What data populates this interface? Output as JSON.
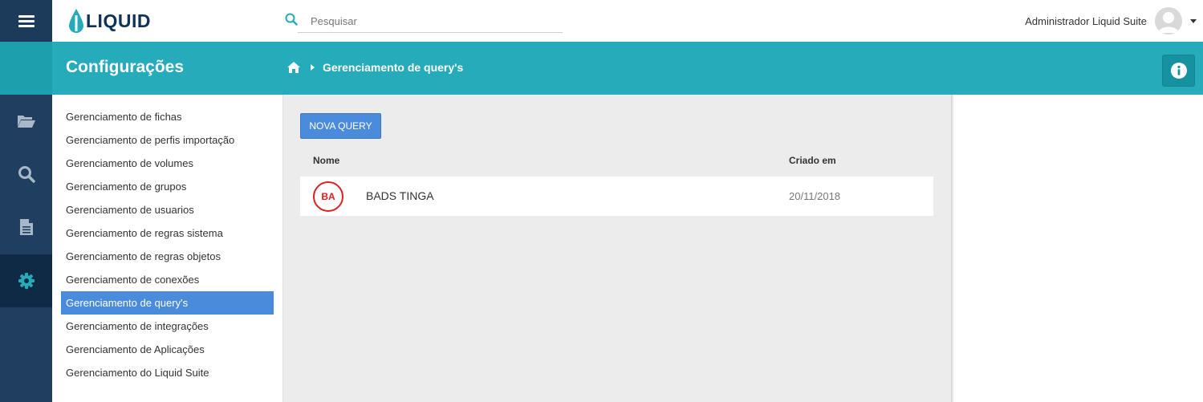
{
  "app": {
    "logo_text": "LIQUID"
  },
  "search": {
    "placeholder": "Pesquisar",
    "value": ""
  },
  "user": {
    "name": "Administrador Liquid Suite"
  },
  "header": {
    "title": "Configurações",
    "breadcrumb_current": "Gerenciamento de query's"
  },
  "settings_menu": {
    "items": [
      {
        "label": "Gerenciamento de fichas",
        "active": false
      },
      {
        "label": "Gerenciamento de perfis importação",
        "active": false
      },
      {
        "label": "Gerenciamento de volumes",
        "active": false
      },
      {
        "label": "Gerenciamento de grupos",
        "active": false
      },
      {
        "label": "Gerenciamento de usuarios",
        "active": false
      },
      {
        "label": "Gerenciamento de regras sistema",
        "active": false
      },
      {
        "label": "Gerenciamento de regras objetos",
        "active": false
      },
      {
        "label": "Gerenciamento de conexões",
        "active": false
      },
      {
        "label": "Gerenciamento de query's",
        "active": true
      },
      {
        "label": "Gerenciamento de integrações",
        "active": false
      },
      {
        "label": "Gerenciamento de Aplicações",
        "active": false
      },
      {
        "label": "Gerenciamento do Liquid Suite",
        "active": false
      }
    ]
  },
  "main": {
    "new_button_label": "NOVA QUERY",
    "columns": {
      "name": "Nome",
      "created": "Criado em"
    },
    "rows": [
      {
        "badge": "BA",
        "name": "BADS TINGA",
        "created": "20/11/2018"
      }
    ]
  },
  "icons": {
    "menu": "hamburger-icon",
    "search": "search-icon",
    "home": "home-icon",
    "info": "info-icon",
    "rail": [
      "folder-open-icon",
      "search-icon",
      "document-icon",
      "gear-icon"
    ]
  },
  "colors": {
    "accent": "#25abba",
    "sidebar": "#1f3e60",
    "primary_button": "#4a8bdc",
    "badge": "#e02020"
  }
}
